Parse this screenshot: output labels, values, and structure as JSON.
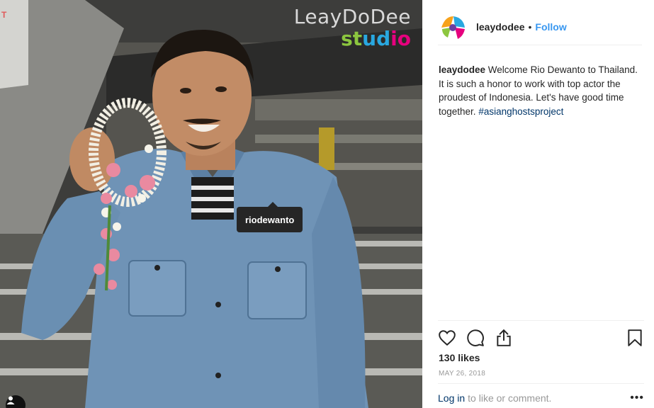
{
  "photo": {
    "watermark_line1": "LeayDoDee",
    "watermark_letters": [
      {
        "ch": "s",
        "color": "#8cc63f"
      },
      {
        "ch": "t",
        "color": "#8cc63f"
      },
      {
        "ch": "u",
        "color": "#29a8e0"
      },
      {
        "ch": "d",
        "color": "#29a8e0"
      },
      {
        "ch": "i",
        "color": "#e6007e"
      },
      {
        "ch": "o",
        "color": "#e6007e"
      }
    ],
    "tag_username": "riodewanto",
    "sign_fragment": "T"
  },
  "header": {
    "username": "leaydodee",
    "separator": "•",
    "follow_label": "Follow"
  },
  "caption": {
    "username": "leaydodee",
    "text": "Welcome Rio Dewanto to Thailand. It is such a honor to work with top actor the proudest of Indonesia. Let's have good time together.",
    "hashtag": "#asianghostsproject"
  },
  "stats": {
    "likes": "130 likes",
    "date": "MAY 26, 2018"
  },
  "comment": {
    "login_link": "Log in",
    "rest_text": "to like or comment.",
    "more_label": "•••"
  },
  "colors": {
    "link_blue": "#3897f0",
    "hashtag_navy": "#003569",
    "border": "#efefef"
  },
  "icons": [
    "heart-icon",
    "comment-icon",
    "share-icon",
    "bookmark-icon",
    "user-tag-icon",
    "more-options-icon"
  ]
}
